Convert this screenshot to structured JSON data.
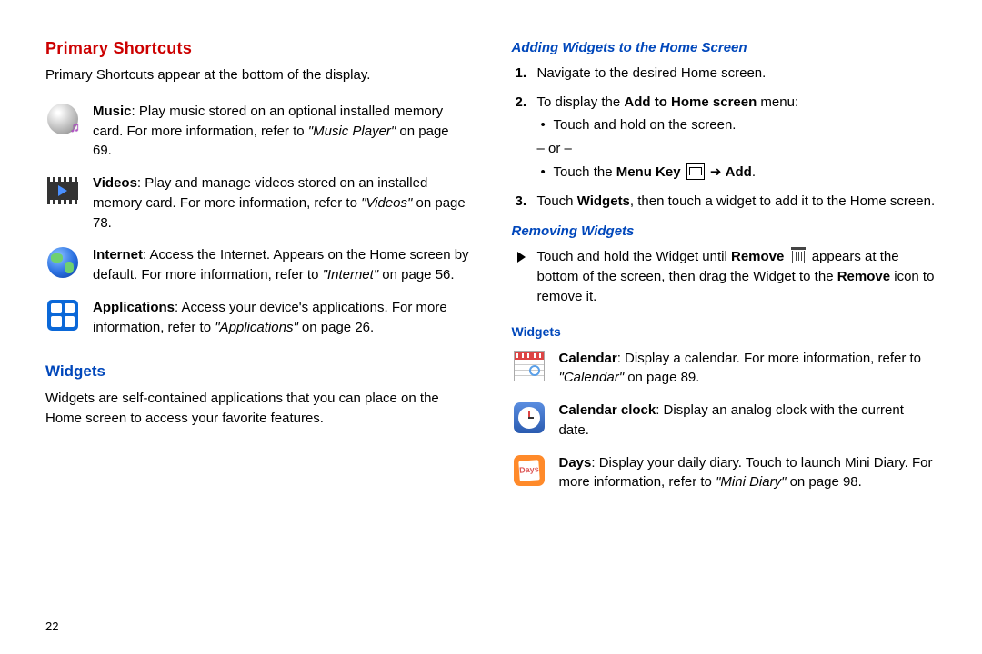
{
  "page_number": "22",
  "left": {
    "h1": "Primary Shortcuts",
    "intro": "Primary Shortcuts appear at the bottom of the display.",
    "items": {
      "music": {
        "label": "Music",
        "body": ": Play music stored on an optional installed memory card. For more information, refer to ",
        "ref": "\"Music Player\"",
        "suffix": " on page 69."
      },
      "videos": {
        "label": "Videos",
        "body": ": Play and manage videos stored on an installed memory card. For more information, refer to ",
        "ref": "\"Videos\"",
        "suffix": " on page 78."
      },
      "internet": {
        "label": "Internet",
        "body": ": Access the Internet. Appears on the Home screen by default. For more information, refer to ",
        "ref": "\"Internet\"",
        "suffix": " on page 56."
      },
      "apps": {
        "label": "Applications",
        "body": ": Access your device's applications. For more information, refer to ",
        "ref": "\"Applications\"",
        "suffix": " on page 26."
      }
    },
    "h2": "Widgets",
    "widgets_intro": "Widgets are self-contained applications that you can place on the Home screen to access your favorite features."
  },
  "right": {
    "h3_add": "Adding Widgets to the Home Screen",
    "steps": {
      "s1": "Navigate to the desired Home screen.",
      "s2": {
        "pre": "To display the ",
        "bold": "Add to Home screen",
        "post": " menu:"
      },
      "s2_b1": "Touch and hold on the screen.",
      "s2_or": "– or –",
      "s2_b2": {
        "pre": "Touch the ",
        "bold1": "Menu Key",
        "arrow": " ➔ ",
        "bold2": "Add",
        "post": "."
      },
      "s3": {
        "pre": "Touch ",
        "bold": "Widgets",
        "post": ", then touch a widget to add it to the Home screen."
      }
    },
    "h3_remove": "Removing Widgets",
    "remove_text": {
      "pre": "Touch and hold the Widget until ",
      "bold1": "Remove",
      "mid": " appears at the bottom of the screen, then drag the Widget to the ",
      "bold2": "Remove",
      "post": " icon to remove it."
    },
    "h4": "Widgets",
    "witems": {
      "calendar": {
        "label": "Calendar",
        "body": ": Display a calendar. For more information, refer to ",
        "ref": "\"Calendar\"",
        "suffix": " on page 89."
      },
      "calclock": {
        "label": "Calendar clock",
        "body": ": Display an analog clock with the current date."
      },
      "days": {
        "label": "Days",
        "body": ": Display your daily diary. Touch to launch Mini Diary. For more information, refer to ",
        "ref": "\"Mini Diary\"",
        "suffix": " on page 98."
      }
    }
  }
}
